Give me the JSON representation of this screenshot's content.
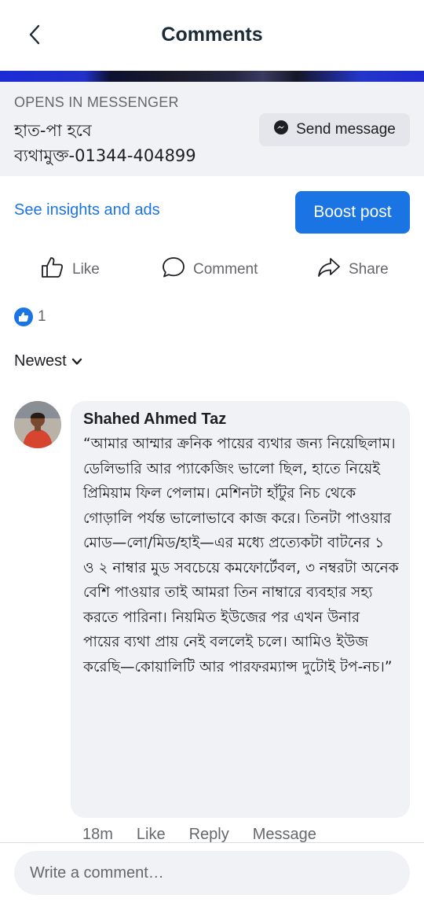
{
  "header": {
    "title": "Comments",
    "back_icon": "chevron-left-icon"
  },
  "cta": {
    "opens_label": "OPENS IN MESSENGER",
    "line1": "হাত-পা হবে",
    "line2": "ব্যথামুক্ত-01344-404899",
    "send_button_label": "Send message",
    "send_icon": "messenger-icon"
  },
  "promo": {
    "insights_label": "See insights and ads",
    "boost_label": "Boost post"
  },
  "actions": {
    "like_label": "Like",
    "comment_label": "Comment",
    "share_label": "Share"
  },
  "reactions": {
    "count": "1",
    "icon": "like-reaction-icon"
  },
  "sort": {
    "label": "Newest"
  },
  "comment": {
    "author": "Shahed Ahmed Taz",
    "text": "“আমার আম্মার ক্রনিক পায়ের ব্যথার জন্য নিয়েছিলাম। ডেলিভারি আর প্যাকেজিং ভালো ছিল, হাতে নিয়েই প্রিমিয়াম ফিল পেলাম। মেশিনটা হাঁটুর নিচ থেকে গোড়ালি পর্যন্ত ভালোভাবে কাজ করে। তিনটা পাওয়ার মোড—লো/মিড/হাই—এর মধ্যে প্রত্যেকটা বাটনের ১ ও ২ নাম্বার মুড সবচেয়ে কমফোর্টেবল, ৩ নম্বরটা অনেক বেশি পাওয়ার তাই আমরা তিন নাম্বারে ব্যবহার সহ্য করতে পারিনা। নিয়মিত ইউজের পর এখন উনার পায়ের ব্যথা প্রায় নেই বললেই চলে। আমিও ইউজ করেছি—কোয়ালিটি আর পারফরম্যান্স দুটোই টপ-নচ।”",
    "time": "18m",
    "like_label": "Like",
    "reply_label": "Reply",
    "message_label": "Message"
  },
  "composer": {
    "placeholder": "Write a comment…"
  },
  "colors": {
    "accent": "#1b74e4",
    "secondary_text": "#65676b",
    "surface": "#f0f2f5"
  }
}
